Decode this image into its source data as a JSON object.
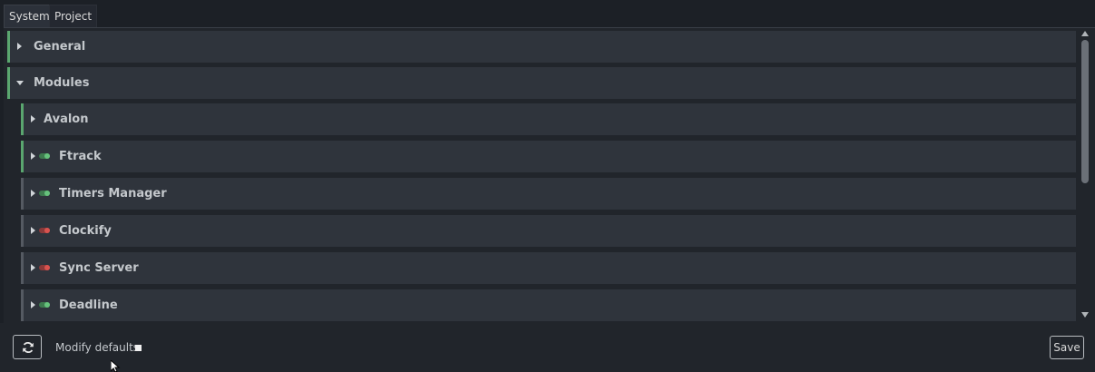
{
  "tabs": [
    {
      "label": "System",
      "active": true
    },
    {
      "label": "Project",
      "active": false
    }
  ],
  "tree": {
    "general": {
      "label": "General",
      "expanded": false,
      "modified": true
    },
    "modules": {
      "label": "Modules",
      "expanded": true,
      "modified": true
    },
    "children": [
      {
        "label": "Avalon",
        "toggle": null,
        "modified": true
      },
      {
        "label": "Ftrack",
        "toggle": "on",
        "modified": true
      },
      {
        "label": "Timers Manager",
        "toggle": "on",
        "modified": false
      },
      {
        "label": "Clockify",
        "toggle": "off",
        "modified": false
      },
      {
        "label": "Sync Server",
        "toggle": "off",
        "modified": false
      },
      {
        "label": "Deadline",
        "toggle": "on",
        "modified": false
      }
    ]
  },
  "footer": {
    "refresh_icon": "refresh-icon",
    "modify_defaults_label": "Modify defaults",
    "modify_defaults_checked": false,
    "save_label": "Save"
  },
  "colors": {
    "modified_accent": "#5aa66f",
    "toggle_on": "#66c27c",
    "toggle_off": "#d9534f"
  }
}
